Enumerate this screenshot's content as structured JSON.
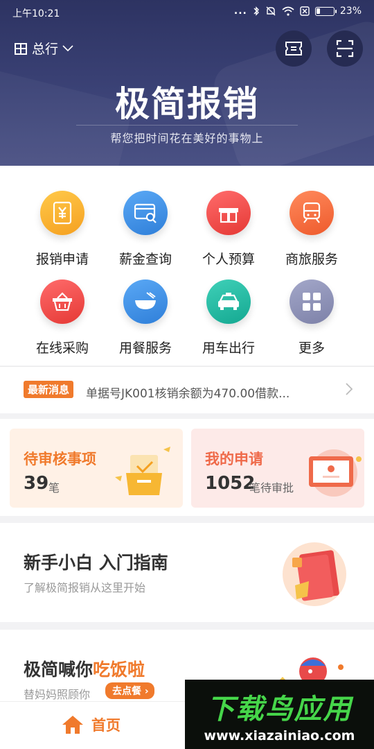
{
  "status_bar": {
    "time": "上午10:21",
    "signal_dots": "...",
    "battery_percent": "23%",
    "battery_level": 0.23
  },
  "header": {
    "branch": "总行",
    "brand_title": "极简报销",
    "slogan": "帮您把时间花在美好的事物上"
  },
  "grid": {
    "items": [
      {
        "label": "报销申请",
        "icon": "receipt-yen-icon",
        "color": "#f9a825"
      },
      {
        "label": "薪金查询",
        "icon": "card-search-icon",
        "color": "#3d8ee6"
      },
      {
        "label": "个人预算",
        "icon": "gift-box-icon",
        "color": "#ef4a4a"
      },
      {
        "label": "商旅服务",
        "icon": "train-icon",
        "color": "#f2693b"
      },
      {
        "label": "在线采购",
        "icon": "basket-icon",
        "color": "#ef4a4a"
      },
      {
        "label": "用餐服务",
        "icon": "bowl-icon",
        "color": "#3d8ee6"
      },
      {
        "label": "用车出行",
        "icon": "taxi-icon",
        "color": "#1fb7a3"
      },
      {
        "label": "更多",
        "icon": "grid-more-icon",
        "color": "#8e92b8"
      }
    ]
  },
  "news": {
    "badge": "最新消息",
    "text": "单据号JK001核销余额为470.00借款..."
  },
  "cards": {
    "pending": {
      "title": "待审核事项",
      "count": "39",
      "unit": "笔"
    },
    "mine": {
      "title": "我的申请",
      "count": "1052",
      "unit": "笔待审批"
    }
  },
  "guide": {
    "title": "新手小白 入门指南",
    "subtitle": "了解极简报销从这里开始"
  },
  "meal": {
    "title_prefix": "极简喊你",
    "title_highlight": "吃饭啦",
    "subtitle": "替妈妈照顾你",
    "button": "去点餐"
  },
  "bottom_nav": {
    "home_label": "首页"
  },
  "watermark": {
    "main": "下载鸟应用",
    "url": "www.xiazainiao.com"
  },
  "colors": {
    "accent": "#f07a2c",
    "header_bg": "#3b4276"
  }
}
